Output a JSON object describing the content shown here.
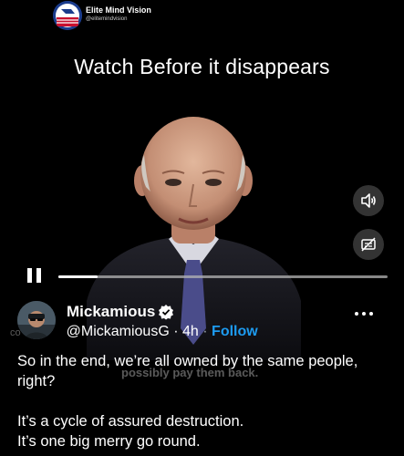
{
  "watermark": {
    "name": "Elite Mind Vision",
    "handle": "@elitemindvision"
  },
  "headline": "Watch Before it disappears",
  "video": {
    "caption": "possibly pay them back.",
    "progress": 0.12,
    "controls": {
      "play_state_icon": "pause-icon",
      "sound_icon": "speaker-icon",
      "captions_icon": "captions-off-icon"
    }
  },
  "tweet": {
    "display_name": "Mickamious",
    "handle": "@MickamiousG",
    "separator": "·",
    "time": "4h",
    "follow_label": "Follow",
    "ghost_prefix": "co",
    "lines": [
      "So in the end, we’re all owned by the same people, right?",
      "It’s a cycle of assured destruction.",
      "It’s one big merry go round."
    ]
  },
  "colors": {
    "accent": "#1d9bf0",
    "background": "#000000",
    "text": "#ffffff"
  }
}
